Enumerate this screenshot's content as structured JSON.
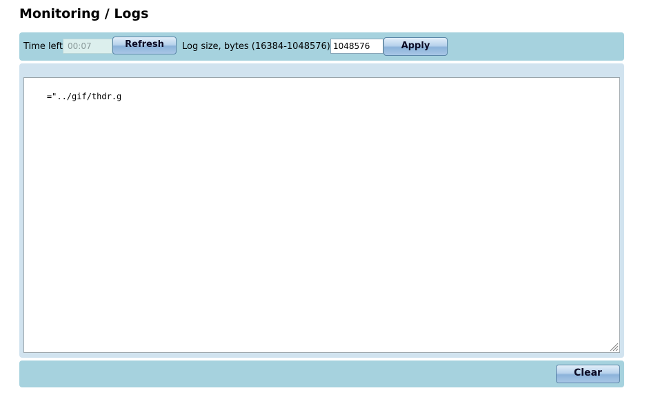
{
  "page": {
    "title": "Monitoring / Logs"
  },
  "toolbar": {
    "time_left_label": "Time left:",
    "time_left_value": "00:07",
    "refresh_label": "Refresh",
    "log_size_label": "Log size, bytes (16384-1048576):",
    "log_size_value": "1048576",
    "apply_label": "Apply"
  },
  "log": {
    "content": "=\"../gif/thdr.g"
  },
  "footer": {
    "clear_label": "Clear"
  },
  "colors": {
    "toolbar_bg": "#a6d2de",
    "panel_bg": "#d1e3ef",
    "button_border": "#5b86a8"
  }
}
